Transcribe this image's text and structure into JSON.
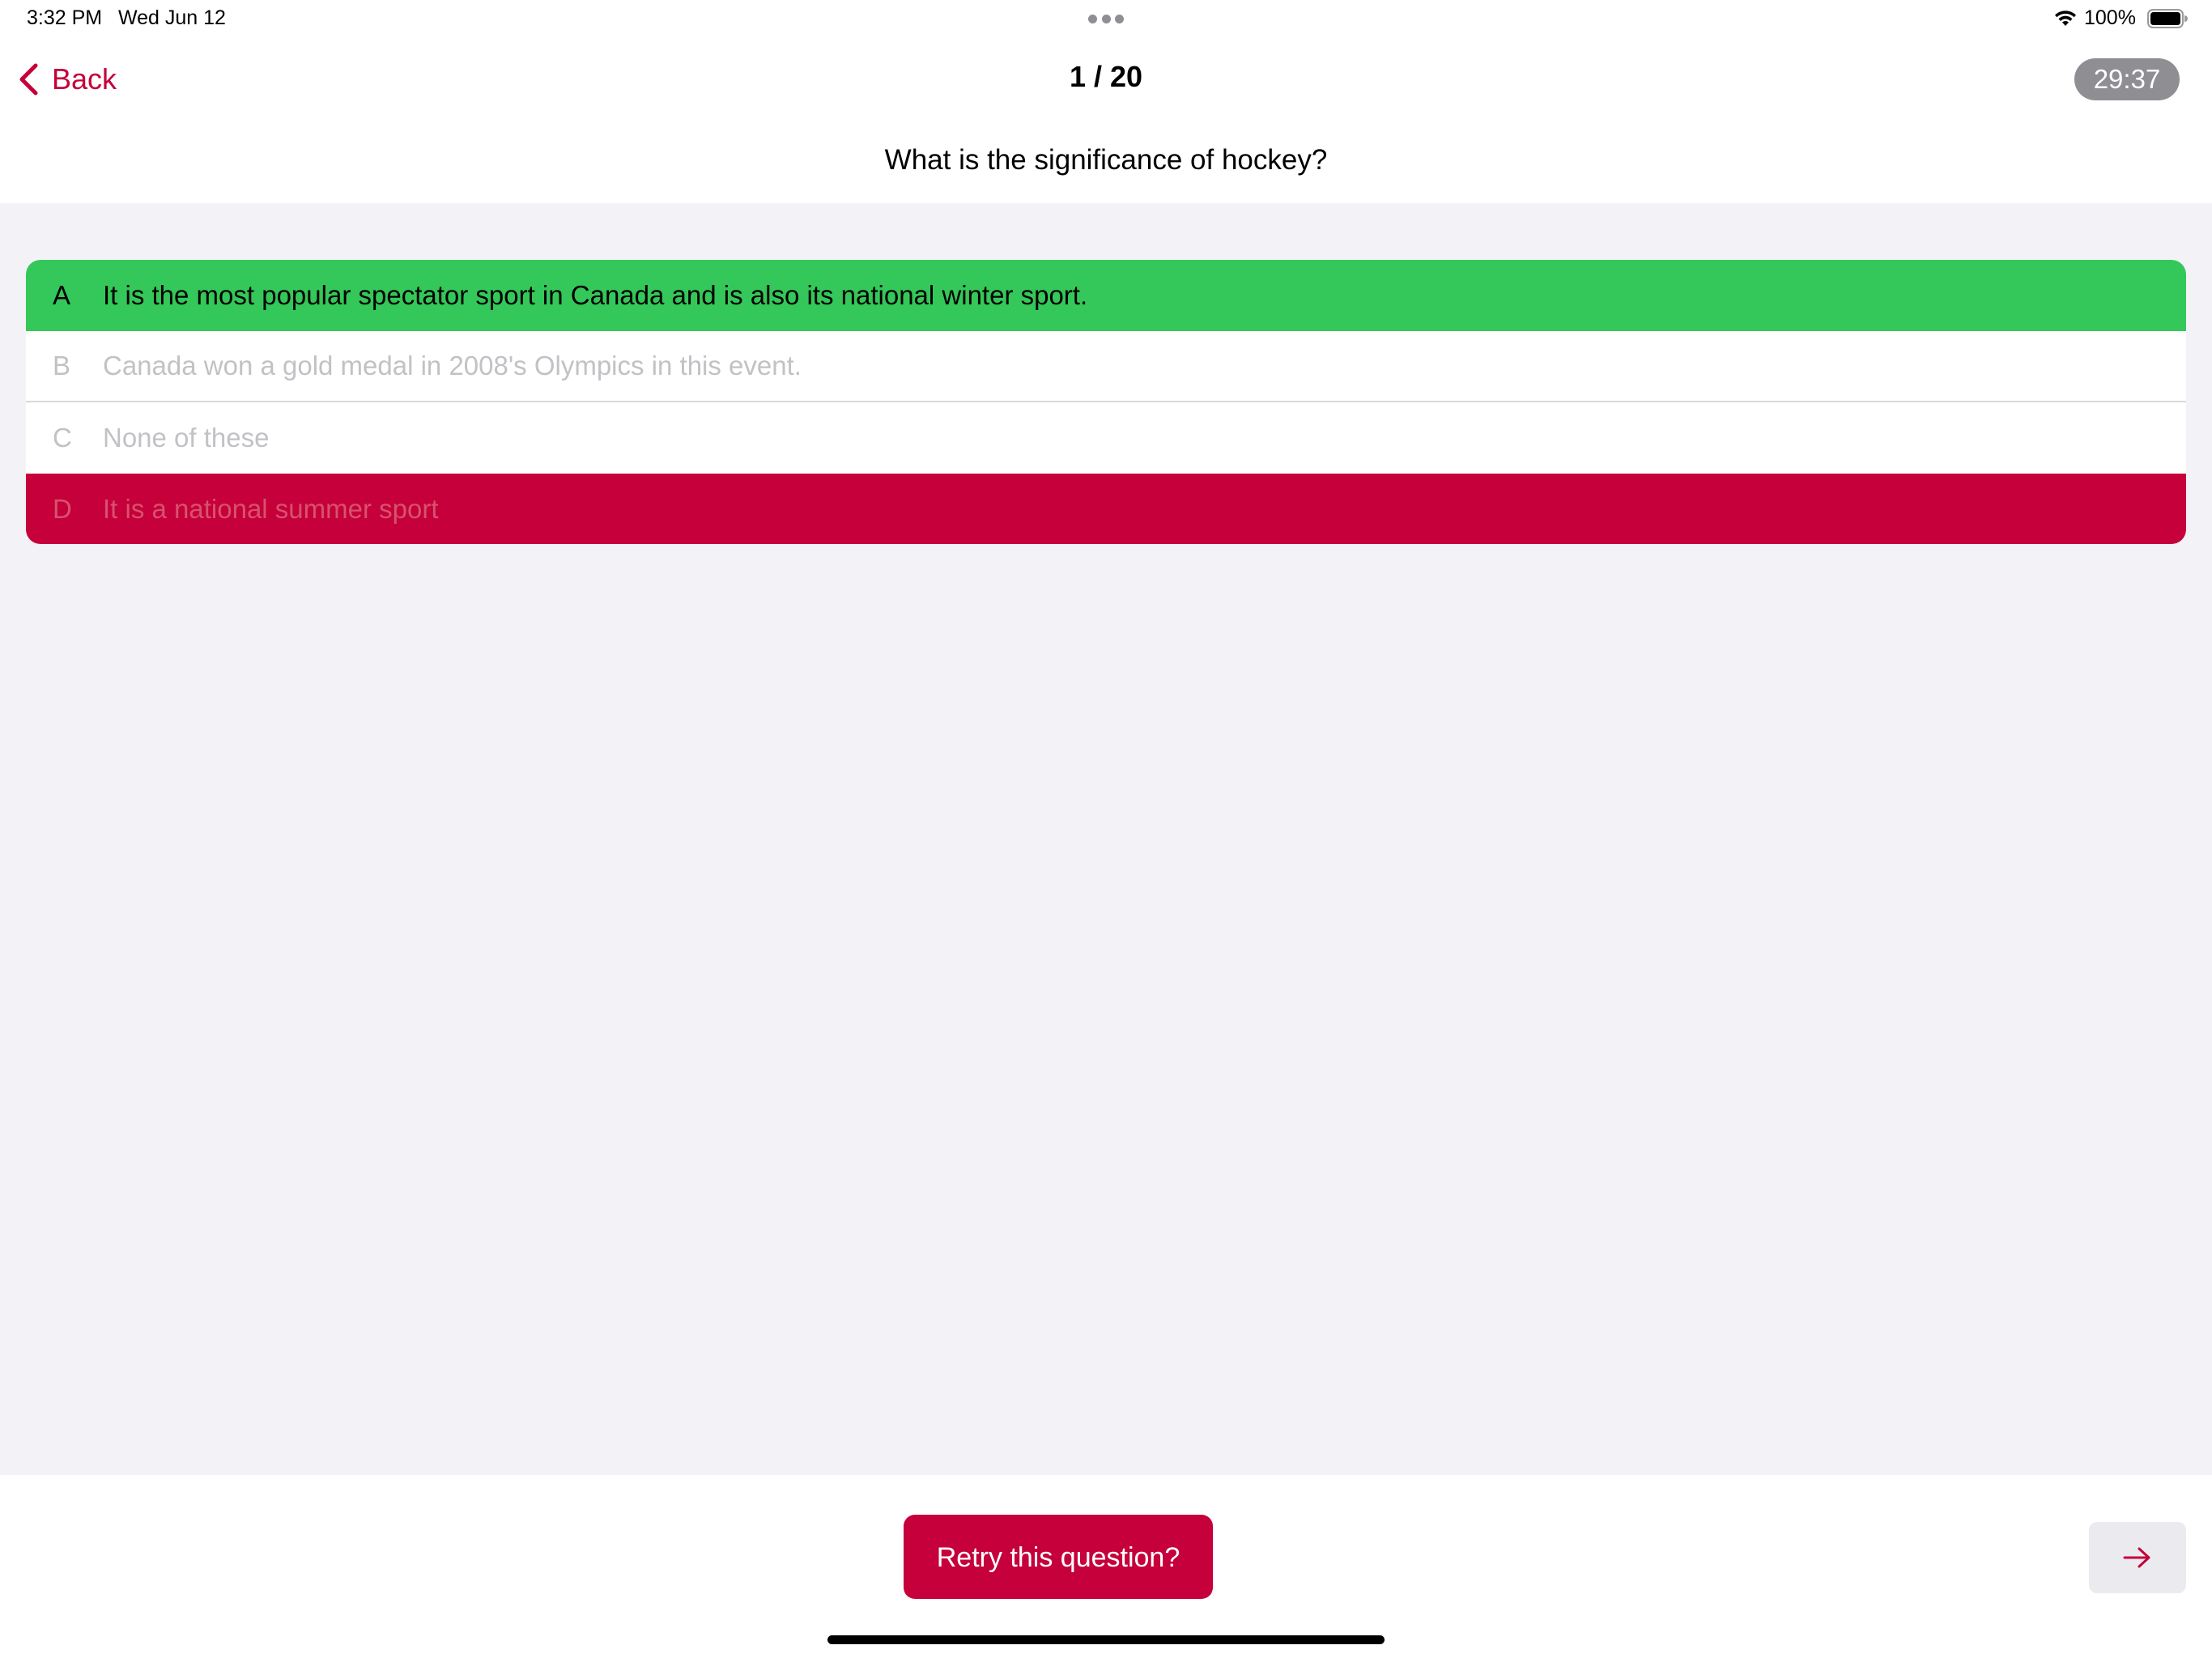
{
  "status_bar": {
    "time": "3:32 PM",
    "date": "Wed Jun 12",
    "battery_percent": "100%",
    "wifi_icon": "wifi-icon",
    "battery_icon": "battery-icon",
    "multitask_icon": "more-dots-icon"
  },
  "nav": {
    "back_label": "Back",
    "back_icon": "chevron-left-icon",
    "progress": "1 / 20",
    "timer": "29:37"
  },
  "question": {
    "text": "What is the significance of hockey?"
  },
  "answers": [
    {
      "letter": "A",
      "text": "It is the most popular spectator sport in Canada and is also its national winter sport.",
      "state": "correct"
    },
    {
      "letter": "B",
      "text": "Canada won a gold medal in 2008's Olympics in this event.",
      "state": "neutral"
    },
    {
      "letter": "C",
      "text": "None of these",
      "state": "neutral"
    },
    {
      "letter": "D",
      "text": "It is a national summer sport",
      "state": "wrong"
    }
  ],
  "footer": {
    "retry_label": "Retry this question?",
    "next_icon": "arrow-right-icon"
  },
  "colors": {
    "accent": "#c5003a",
    "correct": "#34c759",
    "background": "#f2f2f7",
    "timer_badge": "#8e8e93"
  }
}
